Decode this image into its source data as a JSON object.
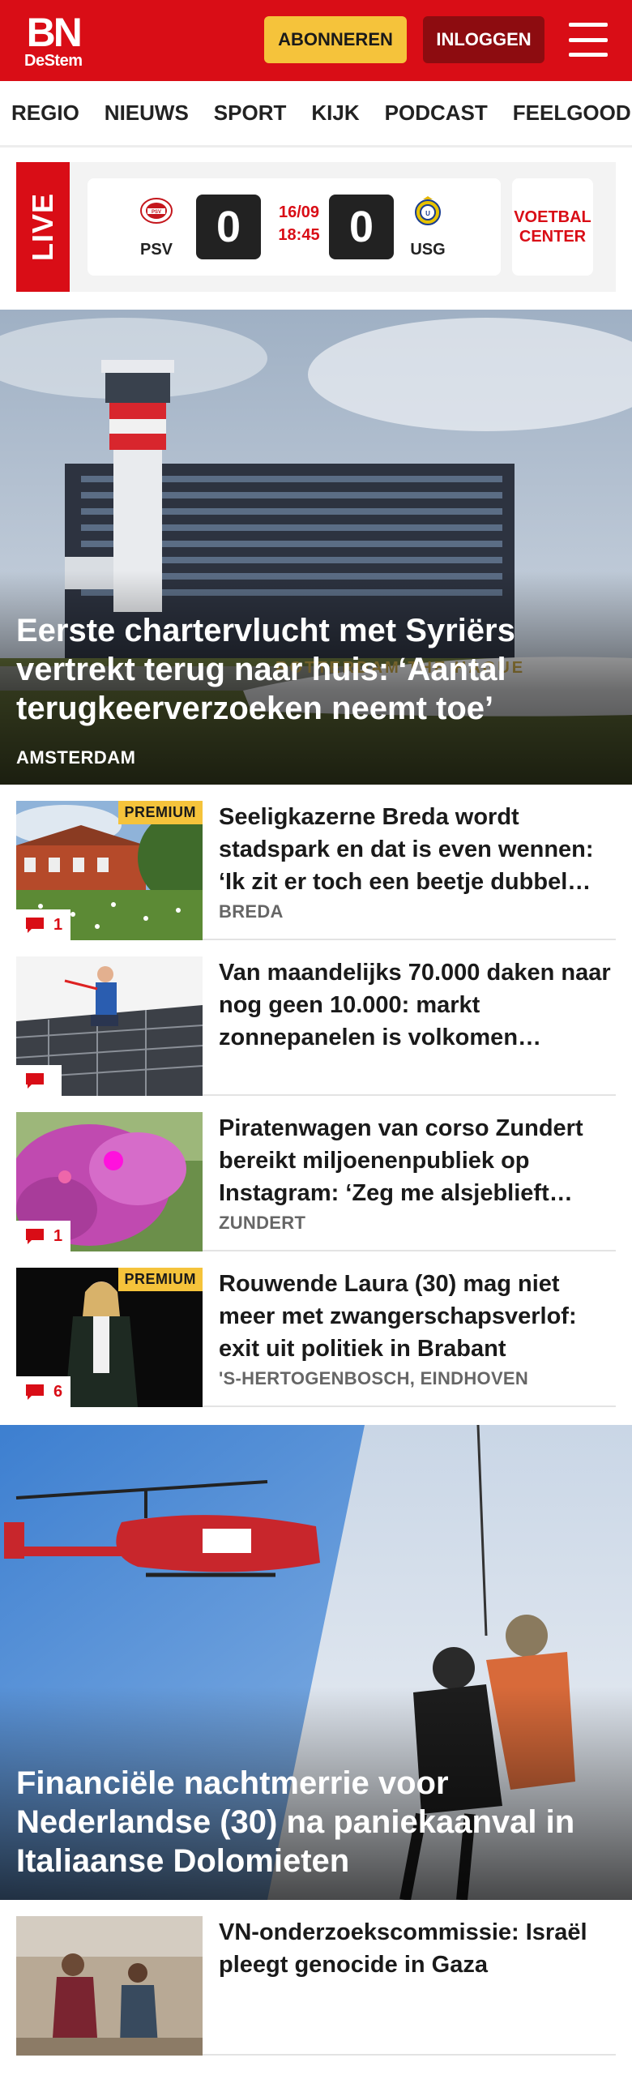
{
  "header": {
    "logo_main": "BN",
    "logo_sub": "DeStem",
    "subscribe_label": "ABONNEREN",
    "login_label": "INLOGGEN",
    "brand_color": "#d90d16"
  },
  "nav": {
    "items": [
      "REGIO",
      "NIEUWS",
      "SPORT",
      "KIJK",
      "PODCAST",
      "FEELGOOD"
    ]
  },
  "live": {
    "label": "LIVE",
    "home_team": "PSV",
    "away_team": "USG",
    "home_score": "0",
    "away_score": "0",
    "date": "16/09",
    "time": "18:45",
    "voetbal_center": "VOETBAL CENTER"
  },
  "hero": {
    "title": "Eerste chartervlucht met Syriërs vertrekt terug naar huis: ‘Aantal terugkeerverzoeken neemt toe’",
    "location": "AMSTERDAM"
  },
  "articles": [
    {
      "title": "Seeligkazerne Breda wordt stadspark en dat is even wennen: ‘Ik zit er toch een beetje dubbel…",
      "location": "BREDA",
      "premium": "PREMIUM",
      "comments": "1"
    },
    {
      "title": "Van maandelijks 70.000 daken naar nog geen 10.000: markt zonnepanelen is volkomen…",
      "location": "",
      "premium": "",
      "comments": ""
    },
    {
      "title": "Piratenwagen van corso Zundert bereikt miljoenenpubliek op Instagram: ‘Zeg me alsjeblieft…",
      "location": "ZUNDERT",
      "premium": "",
      "comments": "1"
    },
    {
      "title": "Rouwende Laura (30) mag niet meer met zwangerschapsverlof: exit uit politiek in Brabant",
      "location": "'S-HERTOGENBOSCH, EINDHOVEN",
      "premium": "PREMIUM",
      "comments": "6"
    }
  ],
  "hero2": {
    "title": "Financiële nachtmerrie voor Nederlandse (30) na paniekaanval in Italiaanse Dolomieten"
  },
  "articles2": [
    {
      "title": "VN-onderzoekscommissie: Israël pleegt genocide in Gaza",
      "location": "",
      "premium": "",
      "comments": ""
    }
  ],
  "icons": {
    "menu": "hamburger-menu-icon",
    "comment": "comment-bubble-icon"
  }
}
